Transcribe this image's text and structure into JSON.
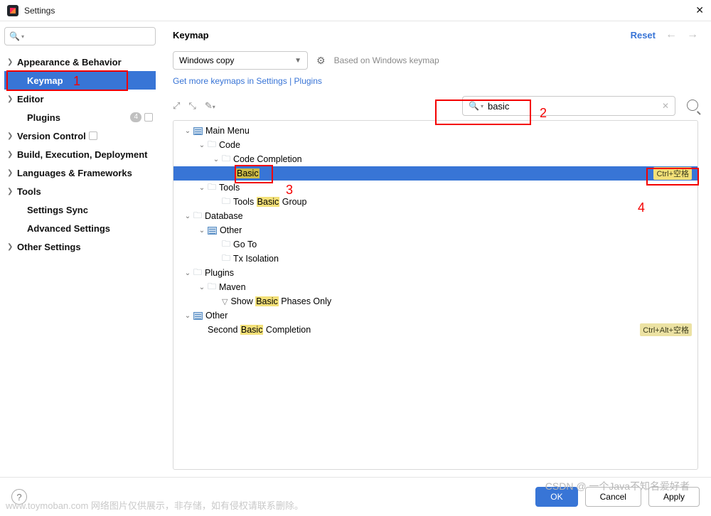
{
  "window": {
    "title": "Settings"
  },
  "sidebar": {
    "search_placeholder": "",
    "items": [
      {
        "label": "Appearance & Behavior",
        "chev": true,
        "bold": true
      },
      {
        "label": "Keymap",
        "chev": false,
        "bold": true,
        "selected": true,
        "child": true
      },
      {
        "label": "Editor",
        "chev": true,
        "bold": true
      },
      {
        "label": "Plugins",
        "chev": false,
        "bold": true,
        "child": true,
        "badge": "4",
        "ctx": true
      },
      {
        "label": "Version Control",
        "chev": true,
        "bold": true,
        "ctx": true
      },
      {
        "label": "Build, Execution, Deployment",
        "chev": true,
        "bold": true
      },
      {
        "label": "Languages & Frameworks",
        "chev": true,
        "bold": true
      },
      {
        "label": "Tools",
        "chev": true,
        "bold": true
      },
      {
        "label": "Settings Sync",
        "chev": false,
        "bold": true,
        "child": true
      },
      {
        "label": "Advanced Settings",
        "chev": false,
        "bold": true,
        "child": true
      },
      {
        "label": "Other Settings",
        "chev": true,
        "bold": true
      }
    ]
  },
  "content": {
    "title": "Keymap",
    "reset": "Reset",
    "dropdown_value": "Windows copy",
    "based_on": "Based on Windows keymap",
    "link": "Get more keymaps in Settings | Plugins",
    "search_value": "basic"
  },
  "tree": [
    {
      "depth": 0,
      "chev": "v",
      "icon": "menu",
      "text": "Main Menu"
    },
    {
      "depth": 1,
      "chev": "v",
      "icon": "folder",
      "text": "Code"
    },
    {
      "depth": 2,
      "chev": "v",
      "icon": "folder",
      "text": "Code Completion"
    },
    {
      "depth": 3,
      "chev": "",
      "icon": "none",
      "text_pre": "",
      "hl": "Basic",
      "text_post": "",
      "shortcut": "Ctrl+空格",
      "selected": true
    },
    {
      "depth": 1,
      "chev": "v",
      "icon": "folder",
      "text": "Tools"
    },
    {
      "depth": 2,
      "chev": "",
      "icon": "folder",
      "text_pre": "Tools ",
      "hl": "Basic",
      "text_post": " Group"
    },
    {
      "depth": 0,
      "chev": "v",
      "icon": "folder",
      "text": "Database"
    },
    {
      "depth": 1,
      "chev": "v",
      "icon": "menu",
      "text": "Other"
    },
    {
      "depth": 2,
      "chev": "",
      "icon": "folder",
      "text": "Go To"
    },
    {
      "depth": 2,
      "chev": "",
      "icon": "folder",
      "text": "Tx Isolation"
    },
    {
      "depth": 0,
      "chev": "v",
      "icon": "folder",
      "text": "Plugins"
    },
    {
      "depth": 1,
      "chev": "v",
      "icon": "folder",
      "text": "Maven"
    },
    {
      "depth": 2,
      "chev": "",
      "icon": "filter",
      "text_pre": "Show ",
      "hl": "Basic",
      "text_post": " Phases Only"
    },
    {
      "depth": 0,
      "chev": "v",
      "icon": "menu",
      "text": "Other"
    },
    {
      "depth": 1,
      "chev": "",
      "icon": "none",
      "text_pre": "Second ",
      "hl": "Basic",
      "text_post": " Completion",
      "shortcut": "Ctrl+Alt+空格"
    }
  ],
  "footer": {
    "ok": "OK",
    "cancel": "Cancel",
    "apply": "Apply"
  },
  "annotations": {
    "l1": "1",
    "l2": "2",
    "l3": "3",
    "l4": "4"
  },
  "watermark": {
    "w1": "www.toymoban.com 网络图片仅供展示，非存储，如有侵权请联系删除。",
    "w2": "CSDN @ 一个Java不知名爱好者"
  }
}
